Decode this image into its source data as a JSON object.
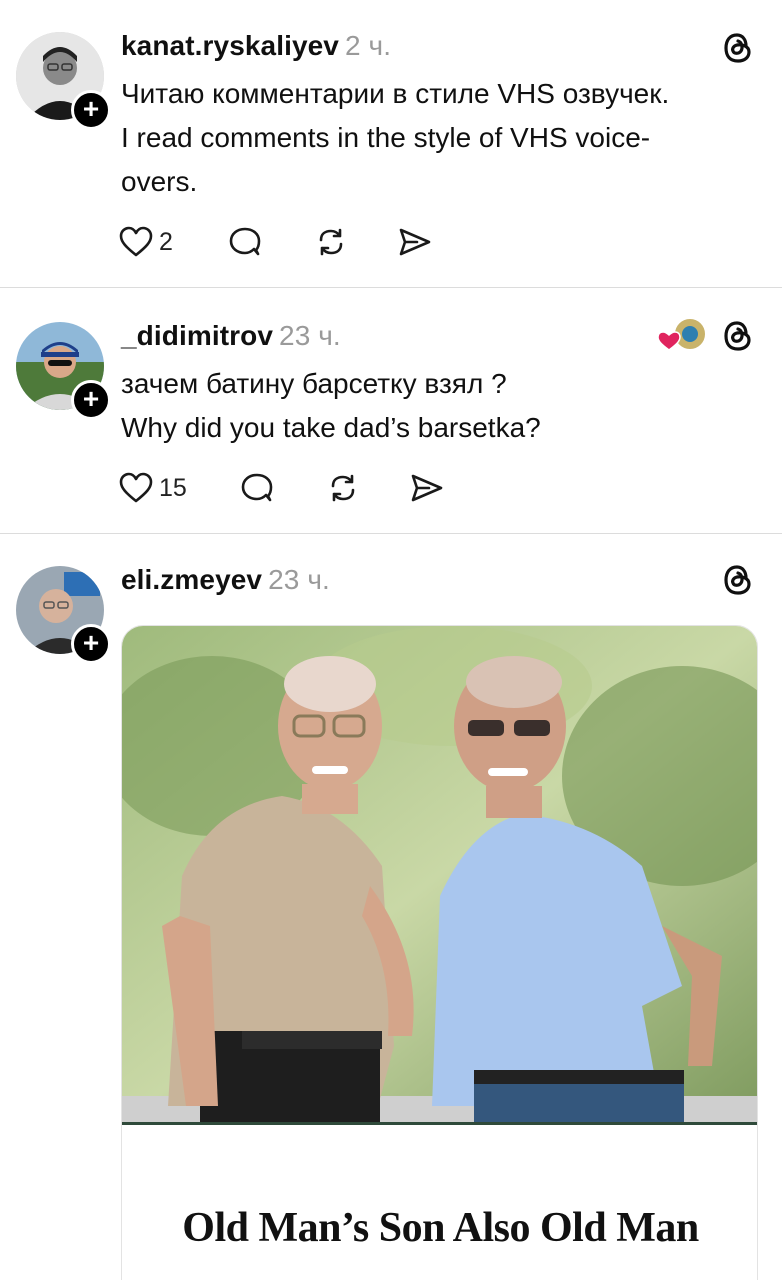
{
  "posts": [
    {
      "username": "kanat.ryskaliyev",
      "time": "2 ч.",
      "text_lines": [
        "Читаю комментарии в стиле VHS озвучек.",
        "I read comments in the style of VHS voice-",
        "overs."
      ],
      "likes": "2",
      "icons": [
        "heart-icon",
        "comment-icon",
        "repost-icon",
        "share-icon",
        "threads-icon"
      ]
    },
    {
      "username": "_didimitrov",
      "time": "23 ч.",
      "text_lines": [
        "зачем батину барсетку взял ?",
        "Why did you take dad’s barsetka?"
      ],
      "likes": "15",
      "icons": [
        "heart-icon",
        "comment-icon",
        "repost-icon",
        "share-icon",
        "threads-icon"
      ]
    },
    {
      "username": "eli.zmeyev",
      "time": "23 ч.",
      "media": {
        "headline": "Old Man’s Son Also Old Man"
      }
    }
  ],
  "colors": {
    "text": "#101010",
    "muted": "#9a9a9a",
    "divider": "#dcdcdc",
    "heart_reaction": "#e0245e"
  }
}
